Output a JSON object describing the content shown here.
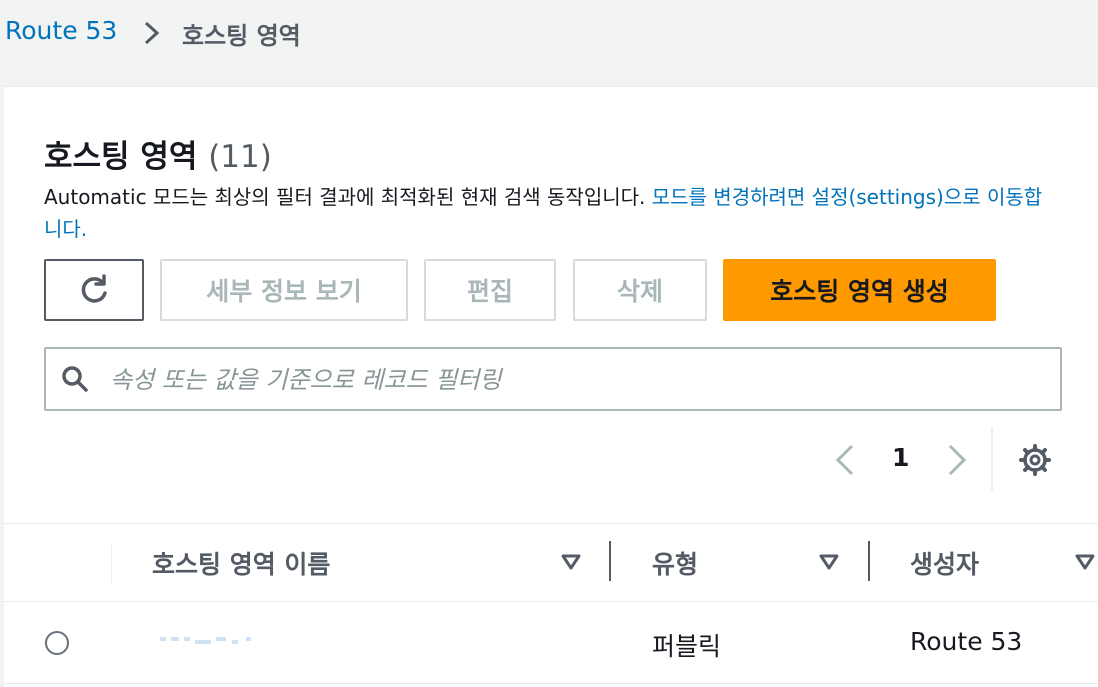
{
  "breadcrumb": {
    "root": "Route 53",
    "current": "호스팅 영역"
  },
  "header": {
    "title": "호스팅 영역",
    "count": "(11)",
    "description": "Automatic 모드는 최상의 필터 결과에 최적화된 현재 검색 동작입니다. ",
    "description_link": "모드를 변경하려면 설정(settings)으로 이동합니다."
  },
  "toolbar": {
    "refresh_icon": "refresh-icon",
    "details_label": "세부 정보 보기",
    "edit_label": "편집",
    "delete_label": "삭제",
    "create_label": "호스팅 영역 생성"
  },
  "search": {
    "placeholder": "속성 또는 값을 기준으로 레코드 필터링",
    "value": ""
  },
  "pagination": {
    "current_page": "1"
  },
  "table": {
    "columns": [
      "호스팅 영역 이름",
      "유형",
      "생성자"
    ],
    "rows": [
      {
        "name": "",
        "type": "퍼블릭",
        "creator": "Route 53"
      }
    ]
  },
  "colors": {
    "link": "#0073bb",
    "primary_button": "#ff9900",
    "disabled_text": "#aab7b8",
    "background": "#f2f3f3"
  }
}
